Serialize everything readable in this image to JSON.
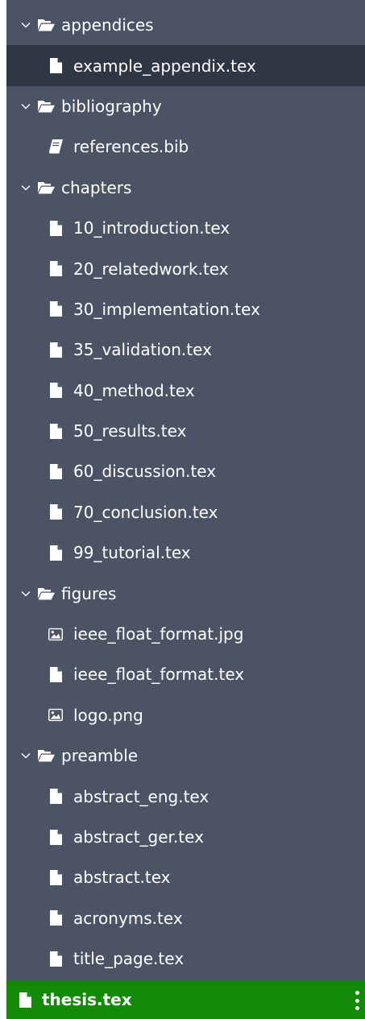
{
  "tree": [
    {
      "kind": "folder",
      "label": "appendices",
      "icon": "folder-open-icon"
    },
    {
      "kind": "file",
      "label": "example_appendix.tex",
      "icon": "file-icon",
      "selected": true
    },
    {
      "kind": "folder",
      "label": "bibliography",
      "icon": "folder-open-icon"
    },
    {
      "kind": "file",
      "label": "references.bib",
      "icon": "book-icon"
    },
    {
      "kind": "folder",
      "label": "chapters",
      "icon": "folder-open-icon"
    },
    {
      "kind": "file",
      "label": "10_introduction.tex",
      "icon": "file-icon"
    },
    {
      "kind": "file",
      "label": "20_relatedwork.tex",
      "icon": "file-icon"
    },
    {
      "kind": "file",
      "label": "30_implementation.tex",
      "icon": "file-icon"
    },
    {
      "kind": "file",
      "label": "35_validation.tex",
      "icon": "file-icon"
    },
    {
      "kind": "file",
      "label": "40_method.tex",
      "icon": "file-icon"
    },
    {
      "kind": "file",
      "label": "50_results.tex",
      "icon": "file-icon"
    },
    {
      "kind": "file",
      "label": "60_discussion.tex",
      "icon": "file-icon"
    },
    {
      "kind": "file",
      "label": "70_conclusion.tex",
      "icon": "file-icon"
    },
    {
      "kind": "file",
      "label": "99_tutorial.tex",
      "icon": "file-icon"
    },
    {
      "kind": "folder",
      "label": "figures",
      "icon": "folder-open-icon"
    },
    {
      "kind": "file",
      "label": "ieee_float_format.jpg",
      "icon": "image-icon"
    },
    {
      "kind": "file",
      "label": "ieee_float_format.tex",
      "icon": "file-icon"
    },
    {
      "kind": "file",
      "label": "logo.png",
      "icon": "image-icon"
    },
    {
      "kind": "folder",
      "label": "preamble",
      "icon": "folder-open-icon"
    },
    {
      "kind": "file",
      "label": "abstract_eng.tex",
      "icon": "file-icon"
    },
    {
      "kind": "file",
      "label": "abstract_ger.tex",
      "icon": "file-icon"
    },
    {
      "kind": "file",
      "label": "abstract.tex",
      "icon": "file-icon"
    },
    {
      "kind": "file",
      "label": "acronyms.tex",
      "icon": "file-icon"
    },
    {
      "kind": "file",
      "label": "title_page.tex",
      "icon": "file-icon"
    }
  ],
  "main_file": {
    "label": "thesis.tex",
    "icon": "file-icon",
    "menu_icon": "kebab-menu-icon"
  },
  "colors": {
    "panel_bg": "#4a5464",
    "selected_bg": "#2f3745",
    "main_file_bg": "#138a07",
    "text": "#ffffff",
    "icon": "#ffffff"
  }
}
